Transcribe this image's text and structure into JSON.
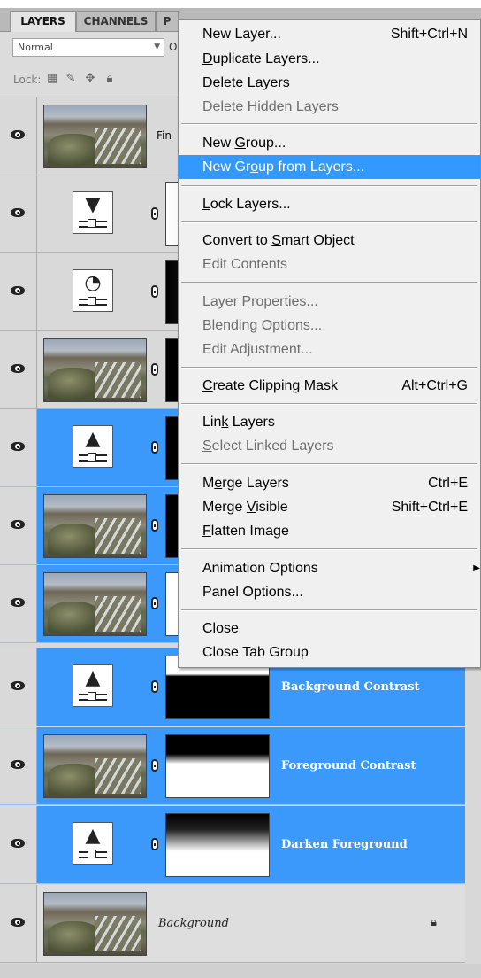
{
  "tabs": {
    "layers": "LAYERS",
    "channels": "CHANNELS",
    "third": "P"
  },
  "blend": {
    "mode": "Normal",
    "opacity_label": "O"
  },
  "lock": {
    "label": "Lock:"
  },
  "layers": [
    {
      "name": "Fin",
      "type": "image",
      "selected": false
    },
    {
      "name": "",
      "type": "adjust-gradient",
      "selected": false
    },
    {
      "name": "",
      "type": "adjust-exposure",
      "selected": false
    },
    {
      "name": "",
      "type": "image-mask",
      "selected": false
    },
    {
      "name": "",
      "type": "adjust-levels",
      "selected": true
    },
    {
      "name": "",
      "type": "image-mask",
      "selected": true
    },
    {
      "name": "",
      "type": "image-mask",
      "selected": true
    },
    {
      "name": "Background Contrast",
      "type": "adjust-levels",
      "selected": true
    },
    {
      "name": "Foreground Contrast",
      "type": "image-mask",
      "selected": true
    },
    {
      "name": "Darken Foreground",
      "type": "adjust-levels",
      "selected": true
    },
    {
      "name": "Background",
      "type": "background",
      "selected": false
    }
  ],
  "menu": {
    "new_layer": {
      "label_pre": "New Layer...",
      "shortcut": "Shift+Ctrl+N"
    },
    "duplicate_layers": {
      "u": "D",
      "rest": "uplicate Layers..."
    },
    "delete_layers": "Delete Layers",
    "delete_hidden_layers": "Delete Hidden Layers",
    "new_group": {
      "pre": "New ",
      "u": "G",
      "rest": "roup..."
    },
    "new_group_from_layers": {
      "pre": "New Gr",
      "u": "o",
      "rest": "up from Layers..."
    },
    "lock_layers": {
      "u": "L",
      "rest": "ock Layers..."
    },
    "convert_smart": {
      "pre": "Convert to ",
      "u": "S",
      "rest": "mart Object"
    },
    "edit_contents": "Edit Contents",
    "layer_properties": {
      "pre": "Layer ",
      "u": "P",
      "rest": "roperties..."
    },
    "blending_options": "Blending Options...",
    "edit_adjustment": "Edit Adjustment...",
    "clipping_mask": {
      "u": "C",
      "rest": "reate Clipping Mask",
      "shortcut": "Alt+Ctrl+G"
    },
    "link_layers": {
      "pre": "Lin",
      "u": "k",
      "rest": " Layers"
    },
    "select_linked": {
      "u": "S",
      "rest": "elect Linked Layers"
    },
    "merge_layers": {
      "pre": "M",
      "u": "e",
      "rest": "rge Layers",
      "shortcut": "Ctrl+E"
    },
    "merge_visible": {
      "pre": "Merge ",
      "u": "V",
      "rest": "isible",
      "shortcut": "Shift+Ctrl+E"
    },
    "flatten_image": {
      "u": "F",
      "rest": "latten Image"
    },
    "animation_options": "Animation Options",
    "panel_options": "Panel Options...",
    "close": "Close",
    "close_tab_group": "Close Tab Group"
  }
}
